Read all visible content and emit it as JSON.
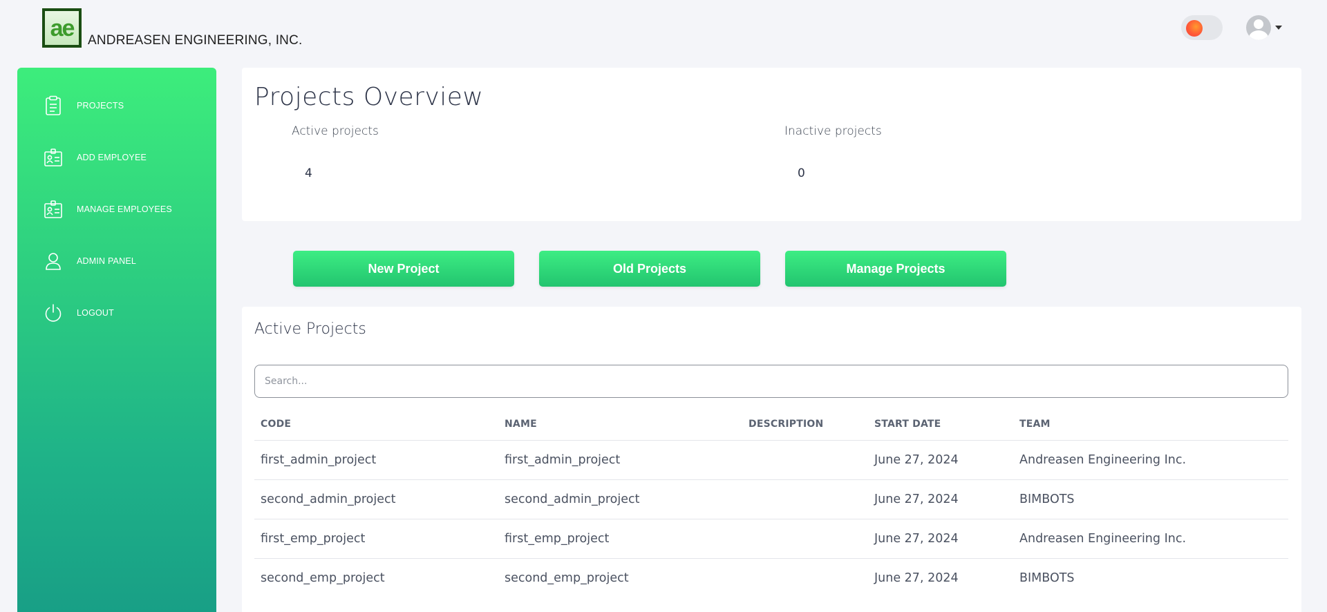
{
  "header": {
    "logo_text": "ae",
    "company_name": "ANDREASEN ENGINEERING, INC."
  },
  "sidebar": {
    "items": [
      {
        "label": "PROJECTS",
        "icon": "clipboard-icon"
      },
      {
        "label": "ADD EMPLOYEE",
        "icon": "id-card-icon"
      },
      {
        "label": "MANAGE EMPLOYEES",
        "icon": "id-card-icon"
      },
      {
        "label": "ADMIN PANEL",
        "icon": "user-icon"
      },
      {
        "label": "LOGOUT",
        "icon": "power-icon"
      }
    ]
  },
  "overview": {
    "title": "Projects Overview",
    "active_label": "Active projects",
    "active_value": "4",
    "inactive_label": "Inactive projects",
    "inactive_value": "0"
  },
  "actions": {
    "new_project": "New Project",
    "old_projects": "Old Projects",
    "manage_projects": "Manage Projects"
  },
  "active_projects": {
    "title": "Active Projects",
    "search_placeholder": "Search...",
    "columns": [
      "CODE",
      "NAME",
      "DESCRIPTION",
      "START DATE",
      "TEAM"
    ],
    "rows": [
      {
        "code": "first_admin_project",
        "name": "first_admin_project",
        "description": "",
        "start_date": "June 27, 2024",
        "team": "Andreasen Engineering Inc."
      },
      {
        "code": "second_admin_project",
        "name": "second_admin_project",
        "description": "",
        "start_date": "June 27, 2024",
        "team": "BIMBOTS"
      },
      {
        "code": "first_emp_project",
        "name": "first_emp_project",
        "description": "",
        "start_date": "June 27, 2024",
        "team": "Andreasen Engineering Inc."
      },
      {
        "code": "second_emp_project",
        "name": "second_emp_project",
        "description": "",
        "start_date": "June 27, 2024",
        "team": "BIMBOTS"
      }
    ]
  },
  "colors": {
    "accent_green": "#2ed080",
    "page_background": "#f4f5f9"
  }
}
